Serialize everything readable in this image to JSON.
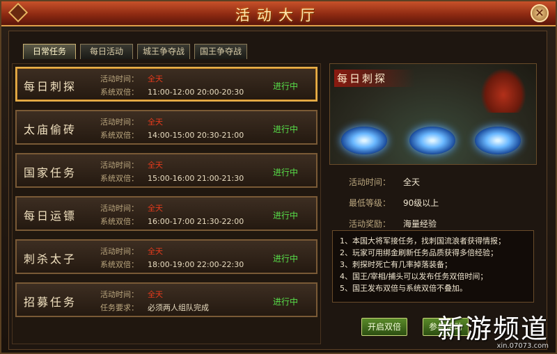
{
  "window": {
    "title": "活动大厅",
    "close_glyph": "✕"
  },
  "tabs": [
    {
      "label": "日常任务",
      "active": true
    },
    {
      "label": "每日活动",
      "active": false
    },
    {
      "label": "城王争夺战",
      "active": false
    },
    {
      "label": "国王争夺战",
      "active": false
    }
  ],
  "tasks": [
    {
      "name": "每日刺探",
      "l1_label": "活动时间：",
      "l1_value": "全天",
      "l2_label": "系统双倍：",
      "l2_value": "11:00-12:00 20:00-20:30",
      "status": "进行中",
      "selected": true
    },
    {
      "name": "太庙偷砖",
      "l1_label": "活动时间：",
      "l1_value": "全天",
      "l2_label": "系统双倍：",
      "l2_value": "14:00-15:00 20:30-21:00",
      "status": "进行中"
    },
    {
      "name": "国家任务",
      "l1_label": "活动时间：",
      "l1_value": "全天",
      "l2_label": "系统双倍：",
      "l2_value": "15:00-16:00 21:00-21:30",
      "status": "进行中"
    },
    {
      "name": "每日运镖",
      "l1_label": "活动时间：",
      "l1_value": "全天",
      "l2_label": "系统双倍：",
      "l2_value": "16:00-17:00 21:30-22:00",
      "status": "进行中"
    },
    {
      "name": "刺杀太子",
      "l1_label": "活动时间：",
      "l1_value": "全天",
      "l2_label": "系统双倍：",
      "l2_value": "18:00-19:00 22:00-22:30",
      "status": "进行中"
    },
    {
      "name": "招募任务",
      "l1_label": "活动时间：",
      "l1_value": "全天",
      "l2_label": "任务要求：",
      "l2_value": "必须两人组队完成",
      "status": "进行中"
    }
  ],
  "detail": {
    "scene_title": "每日刺探",
    "rows": [
      {
        "key": "活动时间：",
        "value": "全天"
      },
      {
        "key": "最低等级：",
        "value": "90级以上"
      },
      {
        "key": "活动奖励：",
        "value": "海量经验"
      }
    ],
    "notes": [
      "1、本国大将军接任务，找刺国流浪者获得情报；",
      "2、玩家可用绑金刷新任务品质获得多倍经验；",
      "3、刺探时死亡有几率掉落装备；",
      "4、国王/宰相/捕头可以发布任务双倍时间；",
      "5、国王发布双倍与系统双倍不叠加。"
    ],
    "buttons": {
      "double": "开启双倍",
      "join": "参与活动"
    }
  },
  "watermark": {
    "main": "新游频道",
    "sub": "xin.07073.com"
  }
}
